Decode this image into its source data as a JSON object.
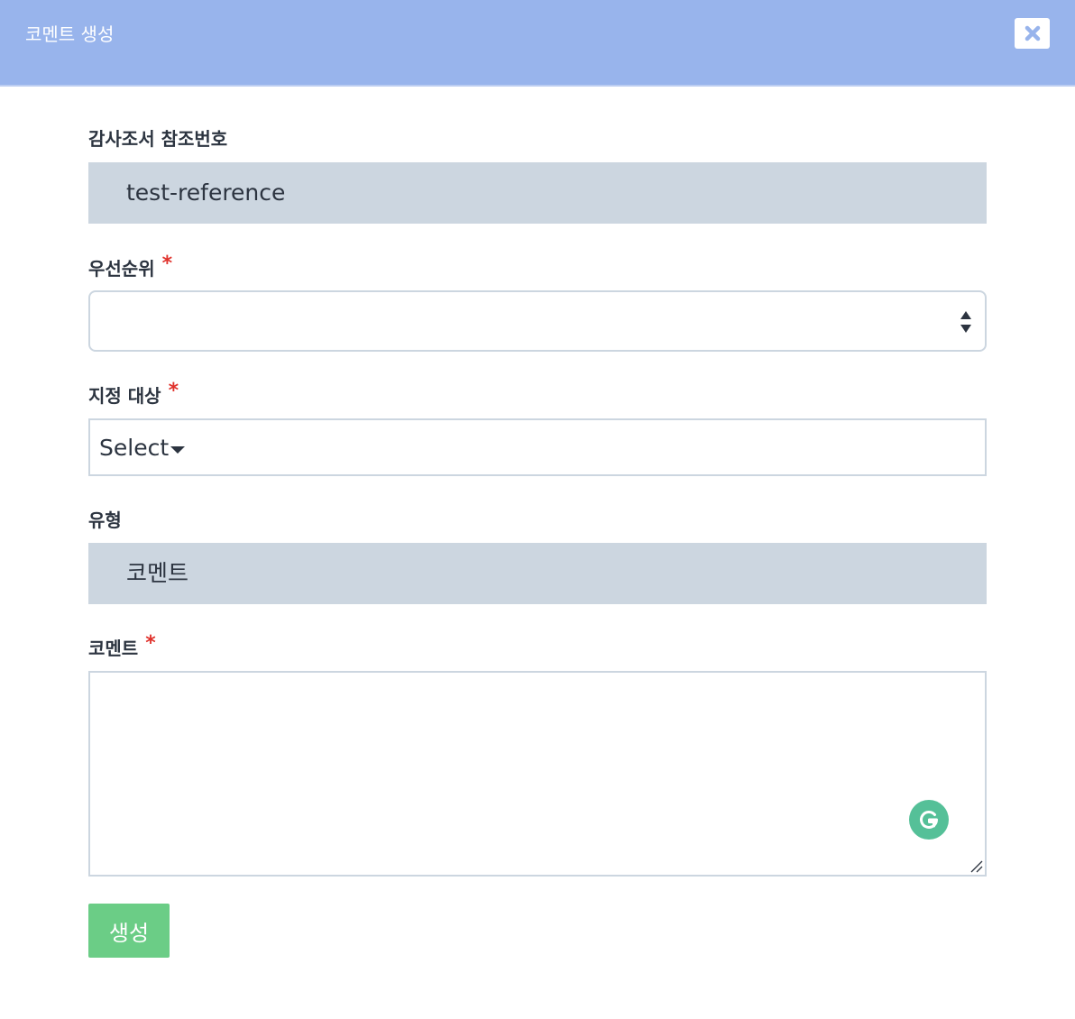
{
  "modal": {
    "title": "코멘트 생성",
    "close_icon": "close-icon"
  },
  "form": {
    "reference": {
      "label": "감사조서 참조번호",
      "value": "test-reference"
    },
    "priority": {
      "label": "우선순위",
      "required_mark": "*",
      "value": ""
    },
    "assignee": {
      "label": "지정 대상",
      "required_mark": "*",
      "value": "Select"
    },
    "type": {
      "label": "유형",
      "value": "코멘트"
    },
    "comment": {
      "label": "코멘트",
      "required_mark": "*",
      "value": ""
    },
    "submit_label": "생성"
  },
  "colors": {
    "header_bg": "#98b4ec",
    "readonly_bg": "#ccd6e0",
    "required": "#e0322c",
    "submit_bg": "#6bcd86",
    "grammarly": "#55c098"
  }
}
